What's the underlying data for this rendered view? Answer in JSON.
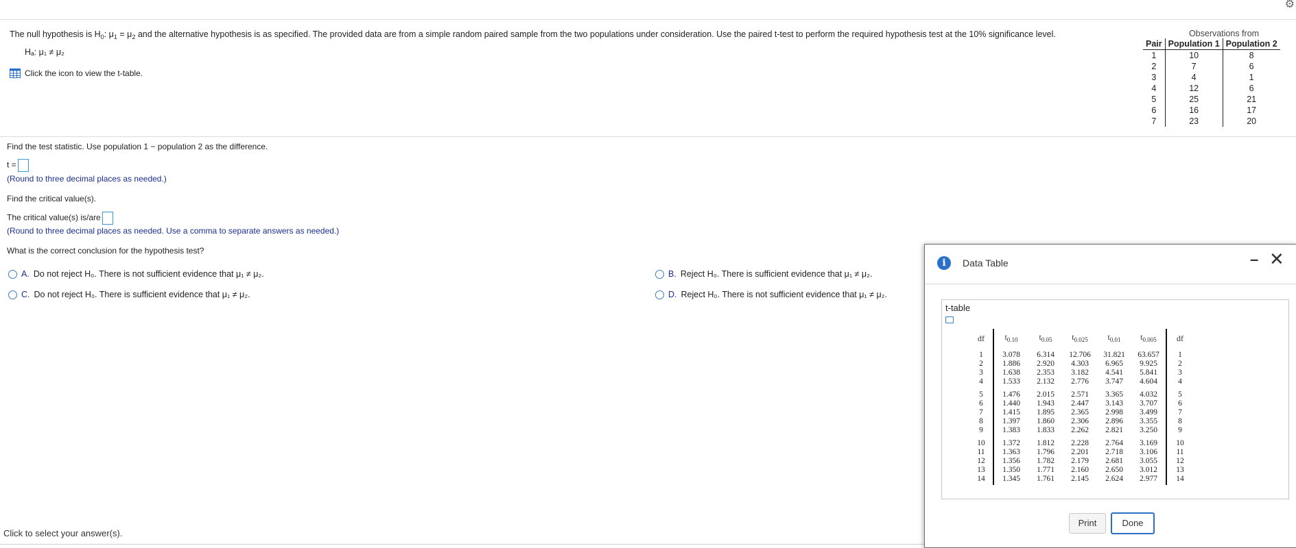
{
  "question": {
    "intro": "The null hypothesis is H",
    "intro_h0_sub": "0",
    "intro_rest": ": μ",
    "intro_text": "and the alternative hypothesis is as specified. The provided data are from a simple random paired sample from the two populations under consideration. Use the paired t-test to perform the required hypothesis test at the 10% significance level.",
    "alt_hyp": "Hₐ: μ₁ ≠ μ₂",
    "table_link": "Click the icon to view the t-table.",
    "obs_title": "Observations from",
    "obs_headers": [
      "Pair",
      "Population 1",
      "Population 2"
    ],
    "obs_rows": [
      [
        "1",
        "10",
        "8"
      ],
      [
        "2",
        "7",
        "6"
      ],
      [
        "3",
        "4",
        "1"
      ],
      [
        "4",
        "12",
        "6"
      ],
      [
        "5",
        "25",
        "21"
      ],
      [
        "6",
        "16",
        "17"
      ],
      [
        "7",
        "23",
        "20"
      ]
    ]
  },
  "parts": {
    "find_stat": "Find the test statistic. Use population 1 − population 2 as the difference.",
    "t_label": "t =",
    "round1": "(Round to three decimal places as needed.)",
    "find_crit": "Find the critical value(s).",
    "crit_label": "The critical value(s) is/are",
    "round2": "(Round to three decimal places as needed. Use a comma to separate answers as needed.)",
    "conclusion_q": "What is the correct conclusion for the hypothesis test?"
  },
  "options": [
    {
      "letter": "A.",
      "text": "Do not reject H₀. There is not sufficient evidence that μ₁ ≠ μ₂."
    },
    {
      "letter": "B.",
      "text": "Reject H₀. There is sufficient evidence that μ₁ ≠ μ₂."
    },
    {
      "letter": "C.",
      "text": "Do not reject H₀. There is sufficient evidence that μ₁ ≠ μ₂."
    },
    {
      "letter": "D.",
      "text": "Reject H₀. There is not sufficient evidence that μ₁ ≠ μ₂."
    }
  ],
  "footer": "Click to select your answer(s).",
  "dialog": {
    "title": "Data Table",
    "minimize": "–",
    "close": "✕",
    "ttable_title": "t-table",
    "col_df": "df",
    "col_heads": [
      "t",
      "t",
      "t",
      "t",
      "t"
    ],
    "col_subs": [
      "0.10",
      "0.05",
      "0.025",
      "0.01",
      "0.005"
    ],
    "groups": [
      {
        "df": [
          "1",
          "2",
          "3",
          "4"
        ],
        "cols": [
          [
            "3.078",
            "1.886",
            "1.638",
            "1.533"
          ],
          [
            "6.314",
            "2.920",
            "2.353",
            "2.132"
          ],
          [
            "12.706",
            "4.303",
            "3.182",
            "2.776"
          ],
          [
            "31.821",
            "6.965",
            "4.541",
            "3.747"
          ],
          [
            "63.657",
            "9.925",
            "5.841",
            "4.604"
          ]
        ]
      },
      {
        "df": [
          "5",
          "6",
          "7",
          "8",
          "9"
        ],
        "cols": [
          [
            "1.476",
            "1.440",
            "1.415",
            "1.397",
            "1.383"
          ],
          [
            "2.015",
            "1.943",
            "1.895",
            "1.860",
            "1.833"
          ],
          [
            "2.571",
            "2.447",
            "2.365",
            "2.306",
            "2.262"
          ],
          [
            "3.365",
            "3.143",
            "2.998",
            "2.896",
            "2.821"
          ],
          [
            "4.032",
            "3.707",
            "3.499",
            "3.355",
            "3.250"
          ]
        ]
      },
      {
        "df": [
          "10",
          "11",
          "12",
          "13",
          "14"
        ],
        "cols": [
          [
            "1.372",
            "1.363",
            "1.356",
            "1.350",
            "1.345"
          ],
          [
            "1.812",
            "1.796",
            "1.782",
            "1.771",
            "1.761"
          ],
          [
            "2.228",
            "2.201",
            "2.179",
            "2.160",
            "2.145"
          ],
          [
            "2.764",
            "2.718",
            "2.681",
            "2.650",
            "2.624"
          ],
          [
            "3.169",
            "3.106",
            "3.055",
            "3.012",
            "2.977"
          ]
        ]
      }
    ],
    "print_label": "Print",
    "done_label": "Done"
  }
}
